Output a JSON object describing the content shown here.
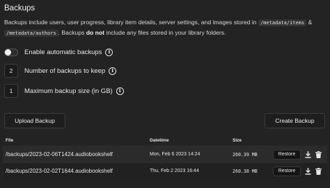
{
  "section": {
    "title": "Backups",
    "description_pre": "Backups include users, user progress, library item details, server settings, and images stored in",
    "code_items": "/metadata/items",
    "amp": "&",
    "code_authors": "/metadata/authors",
    "description_mid": ". Backups",
    "do_not": "do not",
    "description_post": "include any files stored in your library folders."
  },
  "settings": {
    "auto_backups": {
      "label": "Enable automatic backups",
      "enabled": false
    },
    "backups_to_keep": {
      "label": "Number of backups to keep",
      "value": "2"
    },
    "max_backup_size": {
      "label": "Maximum backup size (in GB)",
      "value": "1"
    }
  },
  "buttons": {
    "upload": "Upload Backup",
    "create": "Create Backup"
  },
  "table": {
    "headers": {
      "file": "File",
      "datetime": "Datetime",
      "size": "Size"
    },
    "rows": [
      {
        "file": "/backups/2023-02-06T1424.audiobookshelf",
        "datetime": "Mon, Feb 6 2023 14:24",
        "size": "260.39 MB",
        "restore": "Restore"
      },
      {
        "file": "/backups/2023-02-02T1644.audiobookshelf",
        "datetime": "Thu, Feb 2 2023 16:44",
        "size": "260.38 MB",
        "restore": "Restore"
      }
    ]
  }
}
